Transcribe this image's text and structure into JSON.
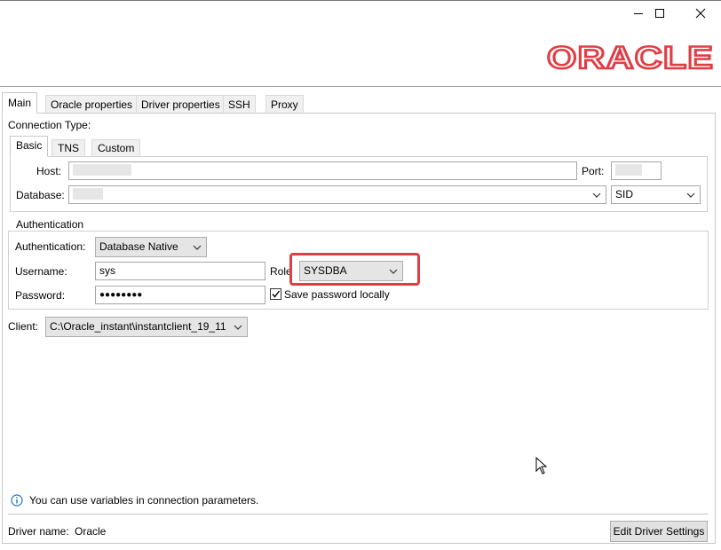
{
  "window": {
    "controls": {
      "minimize": "minimize-icon",
      "maximize": "maximize-icon",
      "close": "close-icon"
    }
  },
  "logo": {
    "text": "ORACLE",
    "color": "#e03e45"
  },
  "tabs": [
    {
      "label": "Main",
      "active": true
    },
    {
      "label": "Oracle properties",
      "active": false
    },
    {
      "label": "Driver properties",
      "active": false
    },
    {
      "label": "SSH",
      "active": false
    },
    {
      "label": "Proxy",
      "active": false
    }
  ],
  "connection": {
    "type_label": "Connection Type:",
    "tabs": [
      {
        "label": "Basic",
        "active": true
      },
      {
        "label": "TNS",
        "active": false
      },
      {
        "label": "Custom",
        "active": false
      }
    ],
    "host_label": "Host:",
    "host_value": "",
    "port_label": "Port:",
    "port_value": "",
    "database_label": "Database:",
    "database_value": "",
    "sid_value": "SID"
  },
  "auth": {
    "group_title": "Authentication",
    "auth_label": "Authentication:",
    "auth_value": "Database Native",
    "username_label": "Username:",
    "username_value": "sys",
    "role_label": "Role",
    "role_value": "SYSDBA",
    "password_label": "Password:",
    "password_value": "●●●●●●●●",
    "save_password_label": "Save password locally",
    "save_password_checked": true
  },
  "client": {
    "label": "Client:",
    "value": "C:\\Oracle_instant\\instantclient_19_11"
  },
  "info": {
    "text": "You can use variables in connection parameters."
  },
  "footer": {
    "driver_name_label": "Driver name:",
    "driver_name_value": "Oracle",
    "edit_driver_button": "Edit Driver Settings"
  },
  "colors": {
    "accent": "#e03e45",
    "info_blue": "#1a73c9"
  }
}
